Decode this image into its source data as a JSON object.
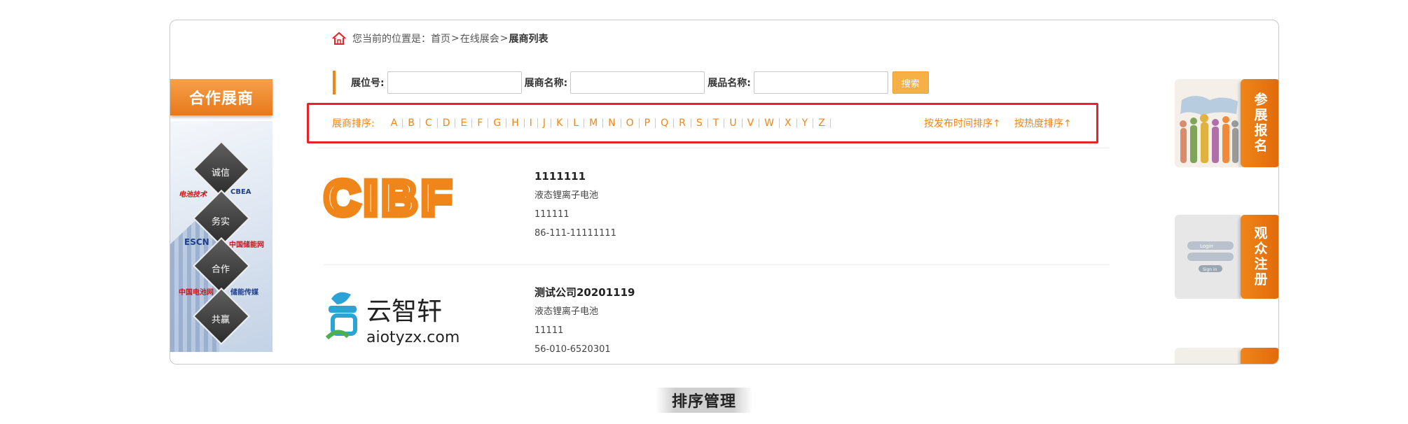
{
  "breadcrumb": {
    "prefix": "您当前的位置是：",
    "home": "首页",
    "sep1": ">",
    "parent": "在线展会",
    "sep2": ">",
    "current": "展商列表"
  },
  "search": {
    "booth_label": "展位号:",
    "booth_value": "",
    "company_label": "展商名称:",
    "company_value": "",
    "product_label": "展品名称:",
    "product_value": "",
    "button": "搜索"
  },
  "left_panel": {
    "title": "合作展商",
    "words": [
      "诚信",
      "务实",
      "合作",
      "共赢"
    ],
    "logos": [
      "电池技术",
      "CBEA",
      "ESCN",
      "中国储能网",
      "中国电池网",
      "储能传媒"
    ]
  },
  "sort": {
    "label": "展商排序:",
    "letters": [
      "A",
      "B",
      "C",
      "D",
      "E",
      "F",
      "G",
      "H",
      "I",
      "J",
      "K",
      "L",
      "M",
      "N",
      "O",
      "P",
      "Q",
      "R",
      "S",
      "T",
      "U",
      "V",
      "W",
      "X",
      "Y",
      "Z"
    ],
    "by_time": "按发布时间排序↑",
    "by_hot": "按热度排序↑"
  },
  "exhibitors": [
    {
      "logo_text": "CIBF",
      "name": "1111111",
      "category": "液态锂离子电池",
      "booth": "111111",
      "phone": "86-111-11111111"
    },
    {
      "logo_cn": "云智轩",
      "logo_en": "aiotyzx.com",
      "name": "测试公司20201119",
      "category": "液态锂离子电池",
      "booth": "11111",
      "phone": "56-010-6520301"
    }
  ],
  "right_panel": {
    "register_exhibit": "参展报名",
    "register_visitor": "观众注册",
    "login_label": "Login",
    "signin_label": "Sign in"
  },
  "caption": "排序管理",
  "colors": {
    "accent": "#f08519",
    "highlight_border": "#e8232a",
    "search_button": "#f6b045"
  }
}
